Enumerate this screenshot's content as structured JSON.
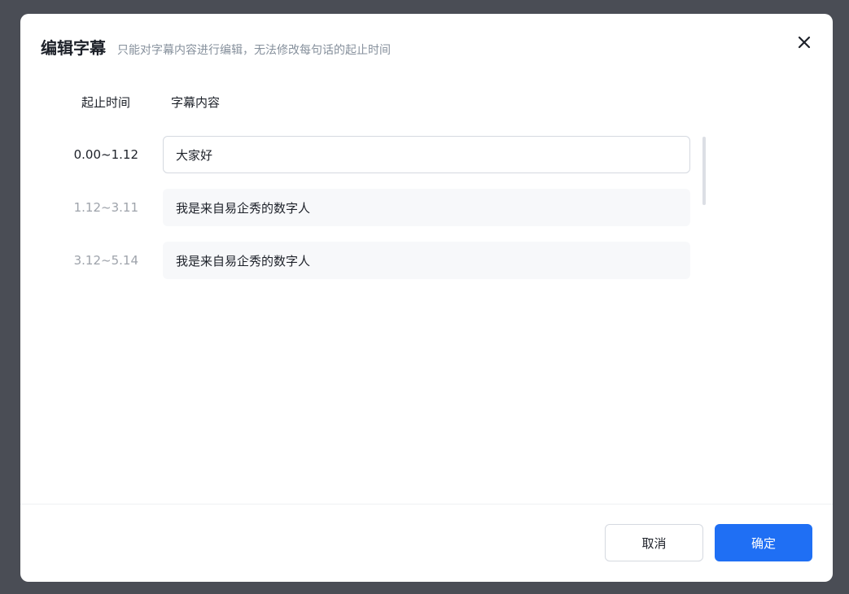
{
  "dialog": {
    "title": "编辑字幕",
    "subtitle": "只能对字幕内容进行编辑，无法修改每句话的起止时间"
  },
  "columns": {
    "time_header": "起止时间",
    "content_header": "字幕内容"
  },
  "rows": [
    {
      "time": "0.00~1.12",
      "content": "大家好",
      "active": true
    },
    {
      "time": "1.12~3.11",
      "content": "我是来自易企秀的数字人",
      "active": false
    },
    {
      "time": "3.12~5.14",
      "content": "我是来自易企秀的数字人",
      "active": false
    }
  ],
  "footer": {
    "cancel_label": "取消",
    "confirm_label": "确定"
  },
  "icons": {
    "close": "close-icon"
  },
  "colors": {
    "accent": "#1f6ff4",
    "overlay": "#4a4d55"
  }
}
